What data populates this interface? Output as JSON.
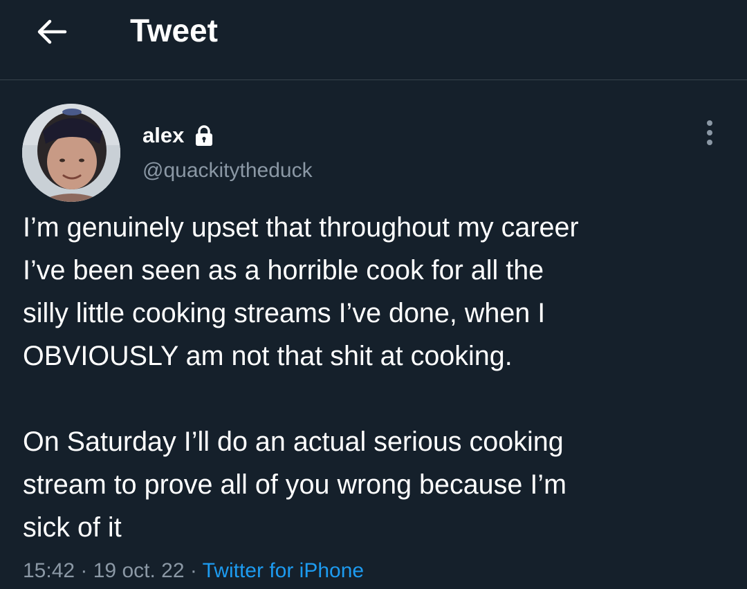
{
  "header": {
    "title": "Tweet",
    "back_icon": "arrow-left-icon"
  },
  "author": {
    "display_name": "alex",
    "handle": "@quackitytheduck",
    "protected_icon": "lock-icon"
  },
  "menu_icon": "more-vertical-icon",
  "tweet": {
    "text": "I’m genuinely upset that throughout my career\nI’ve been seen as a horrible cook for all the\nsilly little cooking streams I’ve done, when I\nOBVIOUSLY am not that shit at cooking.\n\nOn Saturday I’ll do an actual serious cooking\nstream to prove all of you wrong because I’m\nsick of it",
    "time": "15:42",
    "date": "19 oct. 22",
    "separator": " · ",
    "source": "Twitter for iPhone"
  },
  "colors": {
    "background": "#15202b",
    "text_primary": "#ffffff",
    "text_secondary": "#8b98a5",
    "link": "#1d9bf0",
    "divider": "#38444d"
  }
}
